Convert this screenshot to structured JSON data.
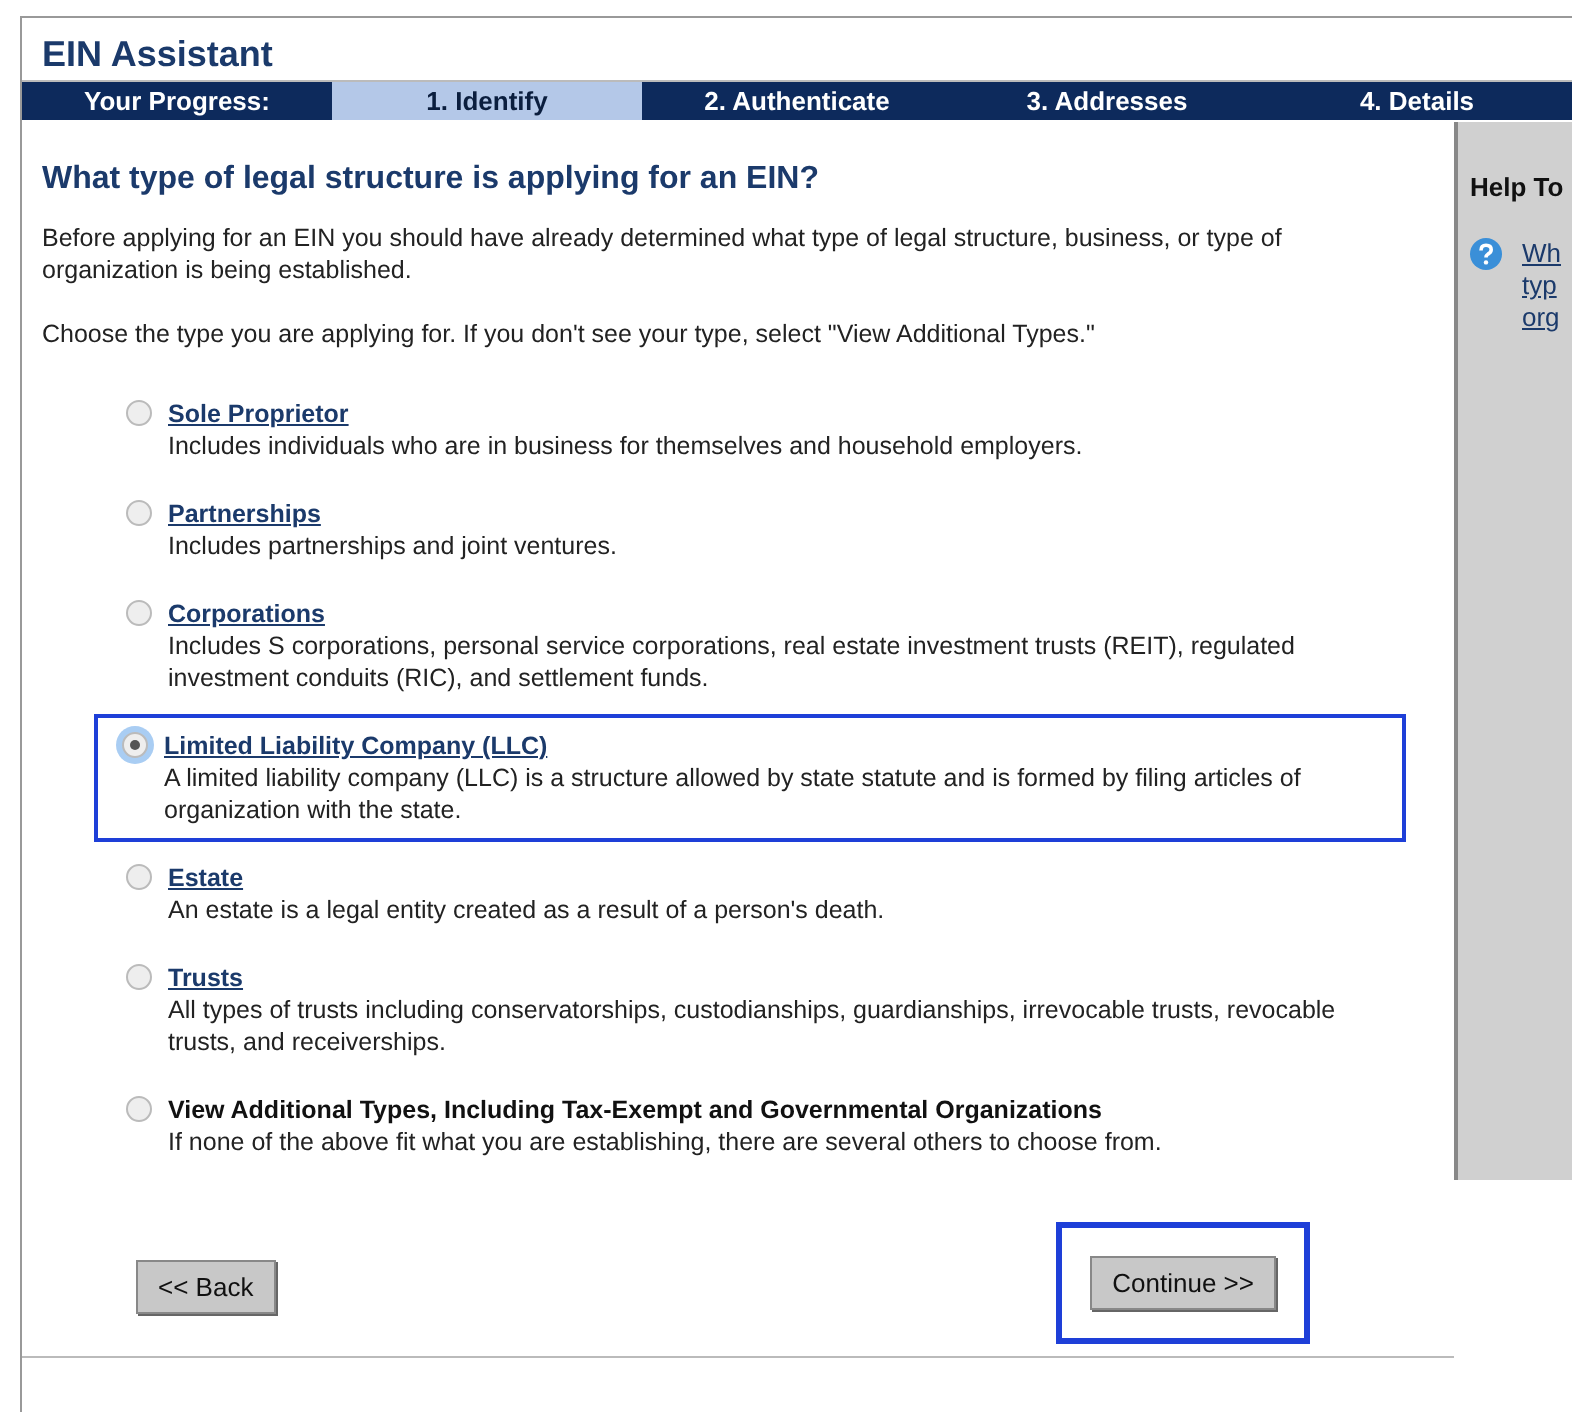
{
  "window": {
    "title": "EIN Assistant"
  },
  "progress": {
    "label": "Your Progress:",
    "steps": [
      {
        "label": "1. Identify",
        "selected": true
      },
      {
        "label": "2. Authenticate",
        "selected": false
      },
      {
        "label": "3. Addresses",
        "selected": false
      },
      {
        "label": "4. Details",
        "selected": false
      }
    ]
  },
  "heading": "What type of legal structure is applying for an EIN?",
  "intro": "Before applying for an EIN you should have already determined what type of legal structure, business, or type of organization is being established.",
  "instruction": "Choose the type you are applying for. If you don't see your type, select \"View Additional Types.\"",
  "options": [
    {
      "kind": "link",
      "label": "Sole Proprietor",
      "description": "Includes individuals who are in business for themselves and household employers.",
      "selected": false,
      "highlighted": false
    },
    {
      "kind": "link",
      "label": "Partnerships",
      "description": "Includes partnerships and joint ventures.",
      "selected": false,
      "highlighted": false
    },
    {
      "kind": "link",
      "label": "Corporations",
      "description": "Includes S corporations, personal service corporations, real estate investment trusts (REIT), regulated investment conduits (RIC), and settlement funds.",
      "selected": false,
      "highlighted": false
    },
    {
      "kind": "link",
      "label": "Limited Liability Company (LLC)",
      "description": "A limited liability company (LLC) is a structure allowed by state statute and is formed by filing articles of organization with the state.",
      "selected": true,
      "highlighted": true
    },
    {
      "kind": "link",
      "label": "Estate",
      "description": "An estate is a legal entity created as a result of a person's death.",
      "selected": false,
      "highlighted": false
    },
    {
      "kind": "link",
      "label": "Trusts",
      "description": "All types of trusts including conservatorships, custodianships, guardianships, irrevocable trusts, revocable trusts, and receiverships.",
      "selected": false,
      "highlighted": false
    },
    {
      "kind": "plain",
      "label": "View Additional Types, Including Tax-Exempt and Governmental Organizations",
      "description": "If none of the above fit what you are establishing, there are several others to choose from.",
      "selected": false,
      "highlighted": false
    }
  ],
  "help": {
    "title": "Help To",
    "link_lines": [
      "Wh",
      "typ",
      "org"
    ]
  },
  "buttons": {
    "back": {
      "label": "<< Back",
      "highlighted": false
    },
    "continue": {
      "label": "Continue >>",
      "highlighted": true
    }
  }
}
